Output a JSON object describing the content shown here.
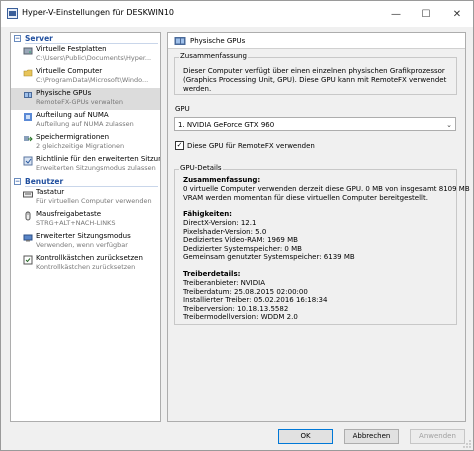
{
  "window": {
    "title": "Hyper-V-Einstellungen für DESKWIN10",
    "controls": {
      "minimize": "—",
      "maximize": "☐",
      "close": "✕"
    }
  },
  "tree": {
    "server": {
      "header": "Server",
      "items": [
        {
          "label": "Virtuelle Festplatten",
          "sub": "C:\\Users\\Public\\Documents\\Hyper...",
          "icon": "hard-disk-icon"
        },
        {
          "label": "Virtuelle Computer",
          "sub": "C:\\ProgramData\\Microsoft\\Windo...",
          "icon": "folder-icon"
        },
        {
          "label": "Physische GPUs",
          "sub": "RemoteFX-GPUs verwalten",
          "icon": "gpu-icon",
          "selected": true
        },
        {
          "label": "Aufteilung auf NUMA",
          "sub": "Aufteilung auf NUMA zulassen",
          "icon": "numa-icon"
        },
        {
          "label": "Speichermigrationen",
          "sub": "2 gleichzeitige Migrationen",
          "icon": "migration-icon"
        },
        {
          "label": "Richtlinie für den erweiterten Sitzun...",
          "sub": "Erweiterten Sitzungsmodus zulassen",
          "icon": "policy-icon"
        }
      ]
    },
    "user": {
      "header": "Benutzer",
      "items": [
        {
          "label": "Tastatur",
          "sub": "Für virtuellen Computer verwenden",
          "icon": "keyboard-icon"
        },
        {
          "label": "Mausfreigabetaste",
          "sub": "STRG+ALT+NACH-LINKS",
          "icon": "mouse-icon"
        },
        {
          "label": "Erweiterter Sitzungsmodus",
          "sub": "Verwenden, wenn verfügbar",
          "icon": "session-icon"
        },
        {
          "label": "Kontrollkästchen zurücksetzen",
          "sub": "Kontrollkästchen zurücksetzen",
          "icon": "reset-icon"
        }
      ]
    }
  },
  "main": {
    "header": "Physische GPUs",
    "summary": {
      "title": "Zusammenfassung",
      "text": "Dieser Computer verfügt über einen einzelnen physischen Grafikprozessor (Graphics Processing Unit, GPU). Diese GPU kann mit RemoteFX verwendet werden."
    },
    "gpu": {
      "label": "GPU",
      "selected": "1. NVIDIA GeForce GTX 960"
    },
    "remotefx_checkbox": {
      "label": "Diese GPU für RemoteFX verwenden",
      "checked": true
    },
    "details": {
      "title": "GPU-Details",
      "summary_heading": "Zusammenfassung:",
      "summary_line1": "0 virtuelle Computer verwenden derzeit diese GPU. 0 MB von insgesamt 8109 MB",
      "summary_line2": "VRAM werden momentan für diese virtuellen Computer bereitgestellt.",
      "caps_heading": "Fähigkeiten:",
      "caps": [
        "DirectX-Version: 12.1",
        "Pixelshader-Version: 5.0",
        "Dediziertes Video-RAM: 1969 MB",
        "Dedizierter Systemspeicher: 0 MB",
        "Gemeinsam genutzter Systemspeicher: 6139 MB"
      ],
      "driver_heading": "Treiberdetails:",
      "driver": [
        "Treiberanbieter: NVIDIA",
        "Treiberdatum: 25.08.2015 02:00:00",
        "Installierter Treiber: 05.02.2016 16:18:34",
        "Treiberversion: 10.18.13.5582",
        "Treibermodellversion: WDDM 2.0"
      ]
    }
  },
  "buttons": {
    "ok": "OK",
    "cancel": "Abbrechen",
    "apply": "Anwenden"
  }
}
